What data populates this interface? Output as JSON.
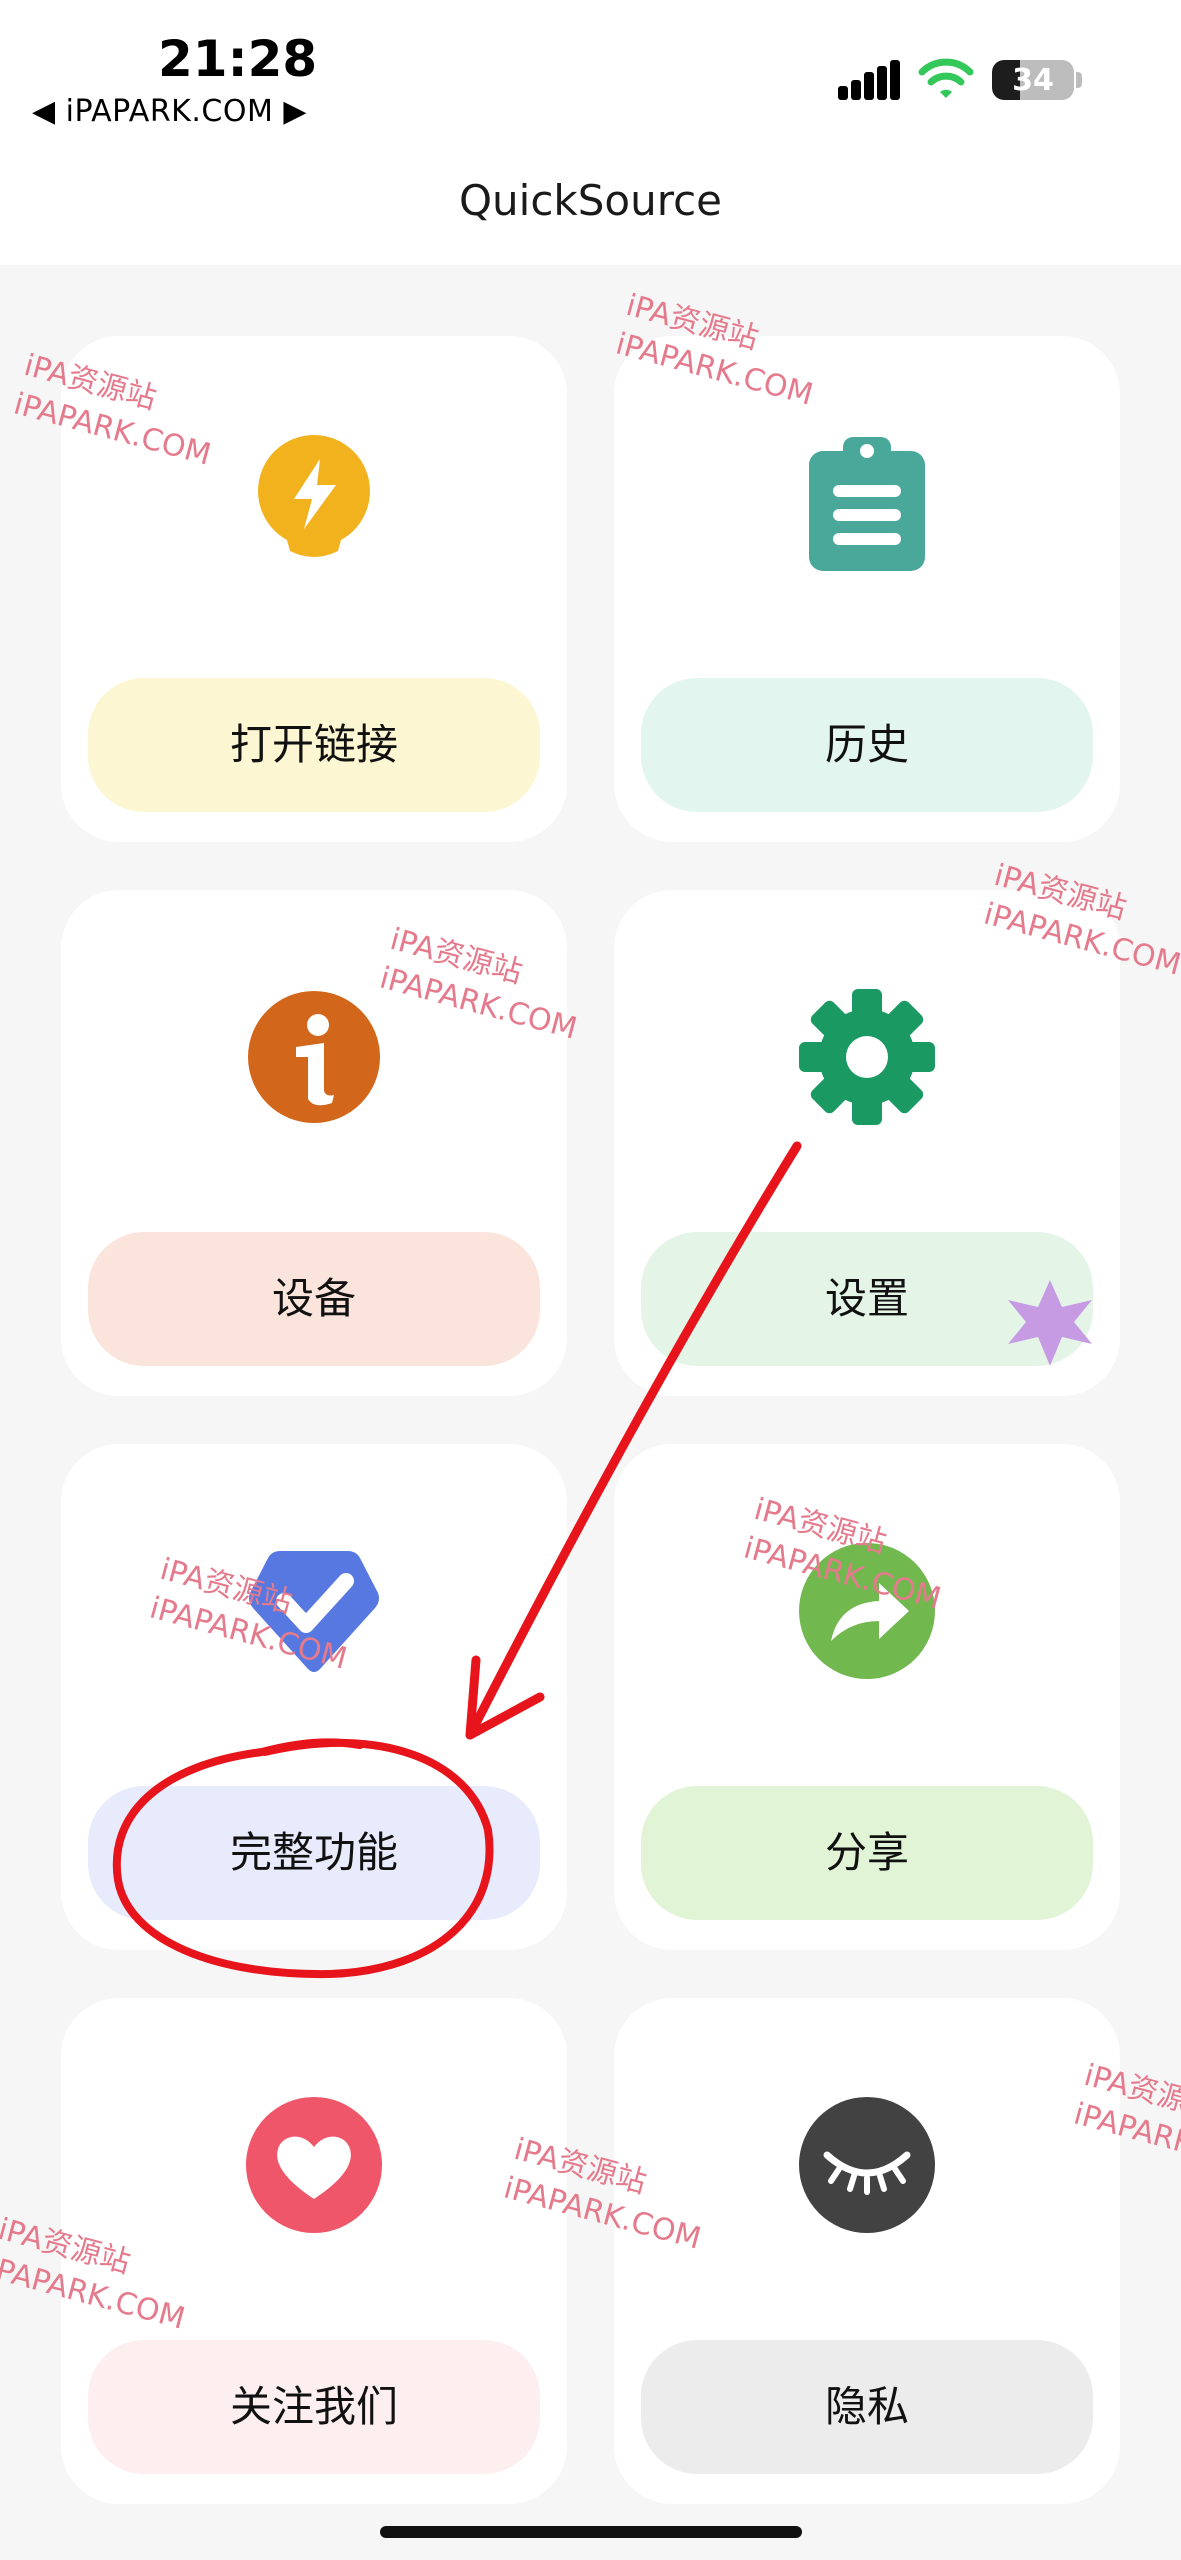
{
  "status_bar": {
    "time": "21:28",
    "back_link": "◀ iPAPARK.COM ▶",
    "battery_level": "34",
    "battery_fraction": 0.34
  },
  "nav": {
    "title": "QuickSource"
  },
  "tiles": [
    {
      "label": "打开链接",
      "icon": "bolt-bulb-icon",
      "icon_color": "#f1b21e",
      "pill_color": "#fdf6d2"
    },
    {
      "label": "历史",
      "icon": "clipboard-icon",
      "icon_color": "#4aa89b",
      "pill_color": "#e3f5ef"
    },
    {
      "label": "设备",
      "icon": "info-icon",
      "icon_color": "#d2661a",
      "pill_color": "#fbe4db"
    },
    {
      "label": "设置",
      "icon": "gear-icon",
      "icon_color": "#1a9a62",
      "pill_color": "#e4f5e8"
    },
    {
      "label": "完整功能",
      "icon": "check-badge-icon",
      "icon_color": "#5678e0",
      "pill_color": "#e7ebfc"
    },
    {
      "label": "分享",
      "icon": "share-arrow-icon",
      "icon_color": "#71b84f",
      "pill_color": "#e1f4d6"
    },
    {
      "label": "关注我们",
      "icon": "heart-icon",
      "icon_color": "#f0566a",
      "pill_color": "#fdefef"
    },
    {
      "label": "隐私",
      "icon": "closed-eye-icon",
      "icon_color": "#424242",
      "pill_color": "#ececec"
    }
  ],
  "watermark": {
    "line1": "iPA资源站",
    "line2": "iPAPARK.COM",
    "color": "#e47a8c"
  },
  "annotation_color": "#e8141c",
  "sparkle_color": "#c79be4"
}
